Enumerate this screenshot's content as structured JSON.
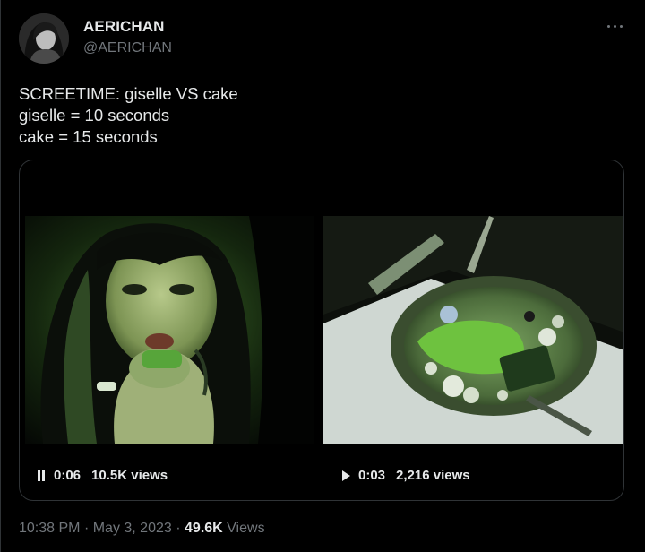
{
  "author": {
    "display_name": "AERICHAN",
    "handle": "@AERICHAN"
  },
  "tweet": {
    "lines": [
      "SCREETIME: giselle VS cake",
      "giselle = 10 seconds",
      "cake = 15 seconds"
    ]
  },
  "media": {
    "videos": [
      {
        "state": "pause-icon",
        "time": "0:06",
        "views": "10.5K views"
      },
      {
        "state": "play-icon",
        "time": "0:03",
        "views": "2,216 views"
      }
    ]
  },
  "meta": {
    "time": "10:38 PM",
    "separator": "·",
    "date": "May 3, 2023",
    "views_count": "49.6K",
    "views_label": "Views"
  },
  "colors": {
    "background": "#000000",
    "primary_text": "#e7e9ea",
    "secondary_text": "#71767b",
    "border": "#2f3336"
  }
}
